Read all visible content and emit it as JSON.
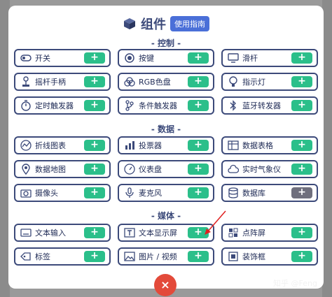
{
  "header": {
    "title": "组件",
    "guide_label": "使用指南"
  },
  "sections": {
    "control": "- 控制 -",
    "data": "- 数据 -",
    "media": "- 媒体 -"
  },
  "items": {
    "switch": {
      "label": "开关",
      "icon": "toggle-icon"
    },
    "button": {
      "label": "按键",
      "icon": "radio-button-icon"
    },
    "slider": {
      "label": "滑杆",
      "icon": "slider-icon"
    },
    "joystick": {
      "label": "摇杆手柄",
      "icon": "joystick-icon"
    },
    "rgb": {
      "label": "RGB色盘",
      "icon": "rgb-icon"
    },
    "indicator": {
      "label": "指示灯",
      "icon": "bulb-icon"
    },
    "timer": {
      "label": "定时触发器",
      "icon": "timer-icon"
    },
    "condition": {
      "label": "条件触发器",
      "icon": "branch-icon"
    },
    "bluetooth": {
      "label": "蓝牙转发器",
      "icon": "bluetooth-icon"
    },
    "linechart": {
      "label": "折线图表",
      "icon": "line-chart-icon"
    },
    "voting": {
      "label": "投票器",
      "icon": "bar-chart-icon"
    },
    "table": {
      "label": "数据表格",
      "icon": "table-icon"
    },
    "map": {
      "label": "数据地图",
      "icon": "map-pin-icon"
    },
    "gauge": {
      "label": "仪表盘",
      "icon": "gauge-icon"
    },
    "weather": {
      "label": "实时气象仪",
      "icon": "weather-icon"
    },
    "camera": {
      "label": "摄像头",
      "icon": "camera-icon"
    },
    "mic": {
      "label": "麦克风",
      "icon": "microphone-icon"
    },
    "database": {
      "label": "数据库",
      "icon": "database-icon"
    },
    "textinput": {
      "label": "文本输入",
      "icon": "keyboard-icon"
    },
    "textdisplay": {
      "label": "文本显示屏",
      "icon": "text-box-icon"
    },
    "dotmatrix": {
      "label": "点阵屏",
      "icon": "dot-matrix-icon"
    },
    "tag": {
      "label": "标签",
      "icon": "tag-icon"
    },
    "image": {
      "label": "图片 / 视频",
      "icon": "image-icon"
    },
    "frame": {
      "label": "装饰框",
      "icon": "frame-icon"
    }
  },
  "plus_label": "+",
  "close_label": "×",
  "watermark": "知乎 @Feng",
  "colors": {
    "accent": "#2bbf8a",
    "primary": "#3c4a7a",
    "close": "#e34a3a",
    "disabled": "#6f6f7d"
  }
}
